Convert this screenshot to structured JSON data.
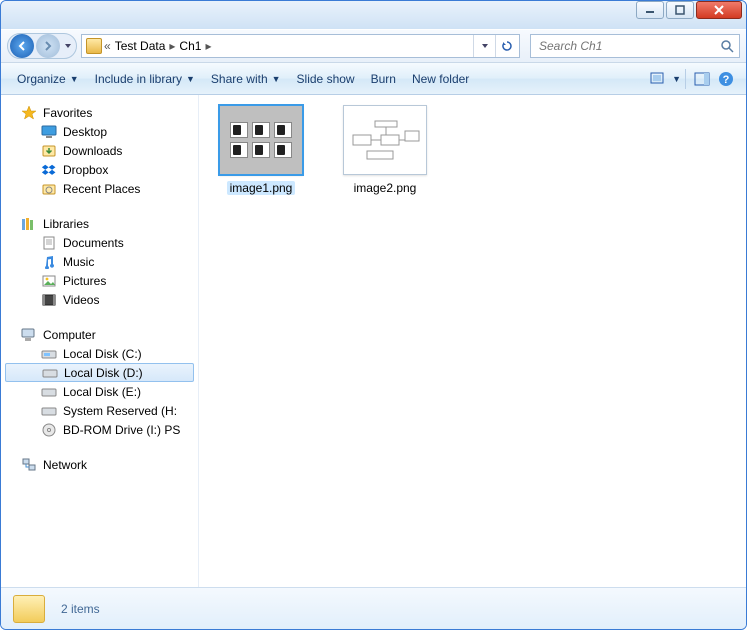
{
  "breadcrumb": {
    "ellipsis": "«",
    "seg1": "Test Data",
    "seg2": "Ch1"
  },
  "search": {
    "placeholder": "Search Ch1"
  },
  "cmd": {
    "organize": "Organize",
    "include": "Include in library",
    "share": "Share with",
    "slideshow": "Slide show",
    "burn": "Burn",
    "newfolder": "New folder"
  },
  "nav": {
    "favorites": {
      "head": "Favorites",
      "desktop": "Desktop",
      "downloads": "Downloads",
      "dropbox": "Dropbox",
      "recent": "Recent Places"
    },
    "libraries": {
      "head": "Libraries",
      "documents": "Documents",
      "music": "Music",
      "pictures": "Pictures",
      "videos": "Videos"
    },
    "computer": {
      "head": "Computer",
      "c": "Local Disk (C:)",
      "d": "Local Disk (D:)",
      "e": "Local Disk (E:)",
      "sr": "System Reserved (H:",
      "bd": "BD-ROM Drive (I:) PS"
    },
    "network": {
      "head": "Network"
    }
  },
  "files": {
    "f1": "image1.png",
    "f2": "image2.png"
  },
  "status": {
    "count": "2 items"
  }
}
